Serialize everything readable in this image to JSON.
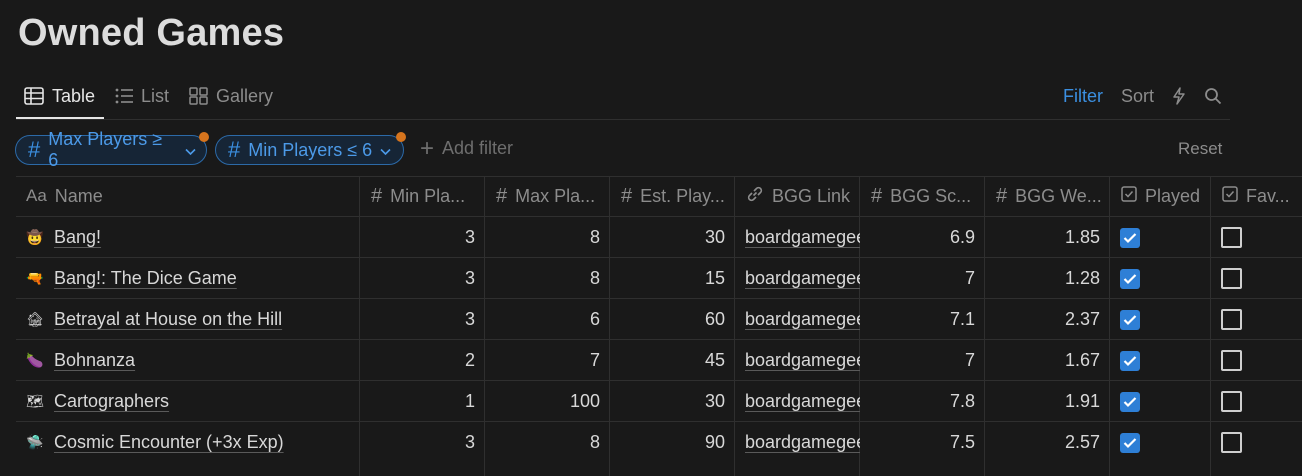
{
  "page": {
    "title": "Owned Games"
  },
  "views": [
    {
      "label": "Table",
      "icon": "table-icon",
      "active": true
    },
    {
      "label": "List",
      "icon": "list-icon",
      "active": false
    },
    {
      "label": "Gallery",
      "icon": "gallery-icon",
      "active": false
    }
  ],
  "toolbar": {
    "filter_label": "Filter",
    "sort_label": "Sort",
    "automation_icon": "lightning-icon",
    "search_icon": "search-icon"
  },
  "filters": [
    {
      "label": "Max Players ≥ 6"
    },
    {
      "label": "Min Players ≤ 6"
    }
  ],
  "add_filter_label": "Add filter",
  "reset_label": "Reset",
  "columns": [
    {
      "label": "Name",
      "icon": "Aa"
    },
    {
      "label": "Min Pla...",
      "icon": "#"
    },
    {
      "label": "Max Pla...",
      "icon": "#"
    },
    {
      "label": "Est. Play...",
      "icon": "#"
    },
    {
      "label": "BGG Link",
      "icon": "link-icon"
    },
    {
      "label": "BGG Sc...",
      "icon": "#"
    },
    {
      "label": "BGG We...",
      "icon": "#"
    },
    {
      "label": "Played",
      "icon": "checkbox-icon"
    },
    {
      "label": "Fav...",
      "icon": "checkbox-icon"
    }
  ],
  "rows": [
    {
      "emoji": "🤠",
      "name": "Bang!",
      "min": "3",
      "max": "8",
      "est": "30",
      "link": "boardgamegeek",
      "score": "6.9",
      "weight": "1.85",
      "played": true,
      "fav": false
    },
    {
      "emoji": "🔫",
      "name": "Bang!: The Dice Game",
      "min": "3",
      "max": "8",
      "est": "15",
      "link": "boardgamegeek",
      "score": "7",
      "weight": "1.28",
      "played": true,
      "fav": false
    },
    {
      "emoji": "🏚",
      "name": "Betrayal at House on the Hill",
      "min": "3",
      "max": "6",
      "est": "60",
      "link": "boardgamegeek",
      "score": "7.1",
      "weight": "2.37",
      "played": true,
      "fav": false
    },
    {
      "emoji": "🍆",
      "name": "Bohnanza",
      "min": "2",
      "max": "7",
      "est": "45",
      "link": "boardgamegeek",
      "score": "7",
      "weight": "1.67",
      "played": true,
      "fav": false
    },
    {
      "emoji": "🗺",
      "name": "Cartographers",
      "min": "1",
      "max": "100",
      "est": "30",
      "link": "boardgamegeek",
      "score": "7.8",
      "weight": "1.91",
      "played": true,
      "fav": false
    },
    {
      "emoji": "🛸",
      "name": "Cosmic Encounter (+3x Exp)",
      "min": "3",
      "max": "8",
      "est": "90",
      "link": "boardgamegeek",
      "score": "7.5",
      "weight": "2.57",
      "played": true,
      "fav": false
    }
  ],
  "colors": {
    "accent": "#2e7fd6",
    "filter_dot": "#d6741d",
    "background": "#191919"
  }
}
